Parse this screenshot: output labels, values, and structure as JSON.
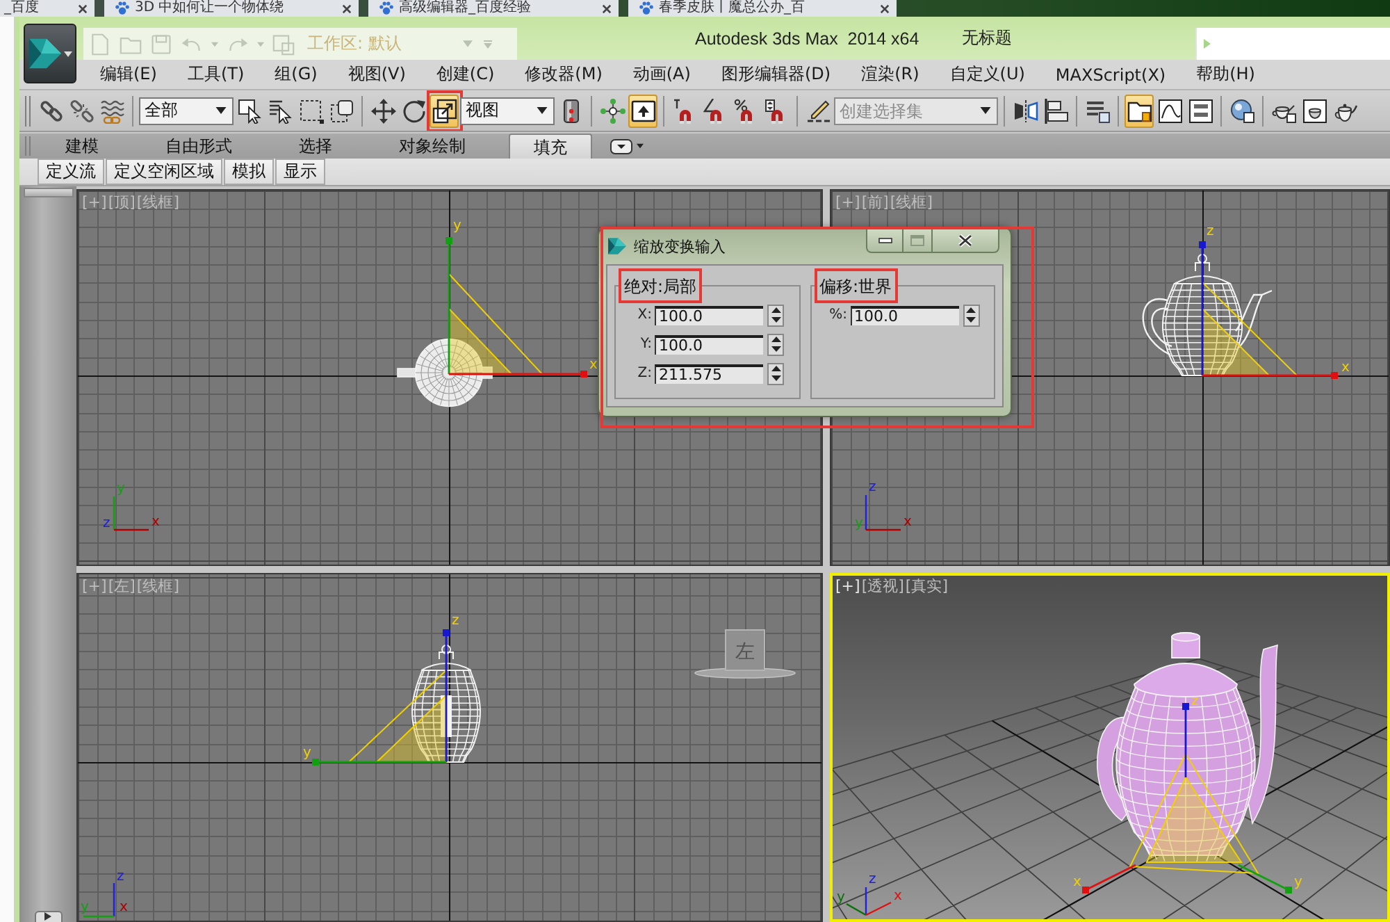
{
  "browser_tabs": [
    {
      "title": "_百度",
      "favicon": false
    },
    {
      "title": "3D 中如何让一个物体绕",
      "favicon": true
    },
    {
      "title": "高级编辑器_百度经验",
      "favicon": true
    },
    {
      "title": "春季皮肤丨魔总公办_百",
      "favicon": true
    }
  ],
  "app": {
    "workspace": "工作区: 默认",
    "title": "Autodesk 3ds Max  2014 x64",
    "document": "无标题"
  },
  "menu": [
    "编辑(E)",
    "工具(T)",
    "组(G)",
    "视图(V)",
    "创建(C)",
    "修改器(M)",
    "动画(A)",
    "图形编辑器(D)",
    "渲染(R)",
    "自定义(U)",
    "MAXScript(X)",
    "帮助(H)"
  ],
  "toolbar_groups": [
    {
      "items": [
        {
          "kind": "icon",
          "on": false,
          "annotated": false
        },
        {
          "kind": "icon",
          "on": false,
          "annotated": false
        },
        {
          "kind": "icon",
          "on": false,
          "annotated": false
        }
      ]
    },
    {
      "items": [
        {
          "kind": "dropdown",
          "value": "全部",
          "on": false,
          "annotated": false
        },
        {
          "kind": "icon",
          "on": false,
          "annotated": false
        },
        {
          "kind": "icon",
          "on": false,
          "annotated": false
        },
        {
          "kind": "icon",
          "on": false,
          "annotated": false
        },
        {
          "kind": "icon",
          "on": false,
          "annotated": false
        }
      ]
    },
    {
      "items": [
        {
          "kind": "icon",
          "on": false,
          "annotated": false
        },
        {
          "kind": "icon",
          "on": false,
          "annotated": false
        },
        {
          "kind": "icon",
          "on": true,
          "annotated": true
        },
        {
          "kind": "dropdown",
          "value": "视图",
          "on": false,
          "annotated": false
        },
        {
          "kind": "icon",
          "on": false,
          "annotated": false
        }
      ]
    },
    {
      "items": [
        {
          "kind": "icon",
          "on": false,
          "annotated": false
        },
        {
          "kind": "icon",
          "on": true,
          "annotated": false
        }
      ]
    },
    {
      "items": [
        {
          "kind": "icon",
          "on": false,
          "annotated": false
        },
        {
          "kind": "icon",
          "on": false,
          "annotated": false
        },
        {
          "kind": "icon",
          "on": false,
          "annotated": false
        },
        {
          "kind": "icon",
          "on": false,
          "annotated": false
        }
      ]
    },
    {
      "items": [
        {
          "kind": "icon",
          "on": false,
          "annotated": false
        },
        {
          "kind": "combo",
          "placeholder": "创建选择集",
          "on": false,
          "annotated": false
        }
      ]
    },
    {
      "items": [
        {
          "kind": "icon",
          "on": false,
          "annotated": false
        },
        {
          "kind": "icon",
          "on": false,
          "annotated": false
        }
      ]
    },
    {
      "items": [
        {
          "kind": "icon",
          "on": false,
          "annotated": false
        }
      ]
    },
    {
      "items": [
        {
          "kind": "icon",
          "on": true,
          "annotated": false
        },
        {
          "kind": "icon",
          "on": false,
          "annotated": false
        },
        {
          "kind": "icon",
          "on": false,
          "annotated": false
        }
      ]
    },
    {
      "items": [
        {
          "kind": "icon",
          "on": false,
          "annotated": false
        }
      ]
    },
    {
      "items": [
        {
          "kind": "icon",
          "on": false,
          "annotated": false
        },
        {
          "kind": "icon",
          "on": false,
          "annotated": false
        },
        {
          "kind": "icon",
          "on": false,
          "annotated": false
        }
      ]
    }
  ],
  "ribbon_tabs": [
    {
      "label": "建模",
      "selected": false
    },
    {
      "label": "自由形式",
      "selected": false
    },
    {
      "label": "选择",
      "selected": false
    },
    {
      "label": "对象绘制",
      "selected": false
    },
    {
      "label": "填充",
      "selected": true
    }
  ],
  "ribbon_buttons": [
    "定义流",
    "定义空闲区域",
    "模拟",
    "显示"
  ],
  "viewports": [
    {
      "menu": "[+]",
      "view": "[顶]",
      "shading": "[线框]",
      "active": false,
      "gizmo": [
        {
          "label": "y",
          "color": "#10a010"
        },
        {
          "label": "x",
          "color": "#e01010"
        }
      ],
      "tripod": [
        {
          "label": "y",
          "color": "#10a010"
        },
        {
          "label": "z",
          "color": "#2020e0"
        },
        {
          "label": "x",
          "color": "#b00000"
        }
      ]
    },
    {
      "menu": "[+]",
      "view": "[前]",
      "shading": "[线框]",
      "active": false,
      "gizmo": [
        {
          "label": "z",
          "color": "#1818d0"
        },
        {
          "label": "x",
          "color": "#e01010"
        }
      ],
      "tripod": [
        {
          "label": "z",
          "color": "#2020e0"
        },
        {
          "label": "y",
          "color": "#10a010"
        },
        {
          "label": "x",
          "color": "#b00000"
        }
      ]
    },
    {
      "menu": "[+]",
      "view": "[左]",
      "shading": "[线框]",
      "active": false,
      "viewcube": "左",
      "gizmo": [
        {
          "label": "z",
          "color": "#1818d0"
        },
        {
          "label": "y",
          "color": "#10a010"
        }
      ],
      "tripod": [
        {
          "label": "z",
          "color": "#2020e0"
        },
        {
          "label": "y",
          "color": "#10a010"
        },
        {
          "label": "x",
          "color": "#b00000"
        }
      ]
    },
    {
      "menu": "[+]",
      "view": "[透视]",
      "shading": "[真实]",
      "active": true,
      "gizmo": [
        {
          "label": "z",
          "color": "#1818d0"
        },
        {
          "label": "x",
          "color": "#e01010"
        },
        {
          "label": "y",
          "color": "#10a010"
        }
      ],
      "tripod": [
        {
          "label": "z",
          "color": "#2020e0"
        },
        {
          "label": "y",
          "color": "#0a700a"
        },
        {
          "label": "x",
          "color": "#e01010"
        }
      ]
    }
  ],
  "dialog": {
    "title": "缩放变换输入",
    "annotated": true,
    "groups": [
      {
        "title": "绝对:局部",
        "annotated": true,
        "fields": [
          {
            "label": "X:",
            "value": "100.0"
          },
          {
            "label": "Y:",
            "value": "100.0"
          },
          {
            "label": "Z:",
            "value": "211.575"
          }
        ]
      },
      {
        "title": "偏移:世界",
        "annotated": true,
        "fields": [
          {
            "label": "%:",
            "value": "100.0"
          }
        ]
      }
    ]
  }
}
